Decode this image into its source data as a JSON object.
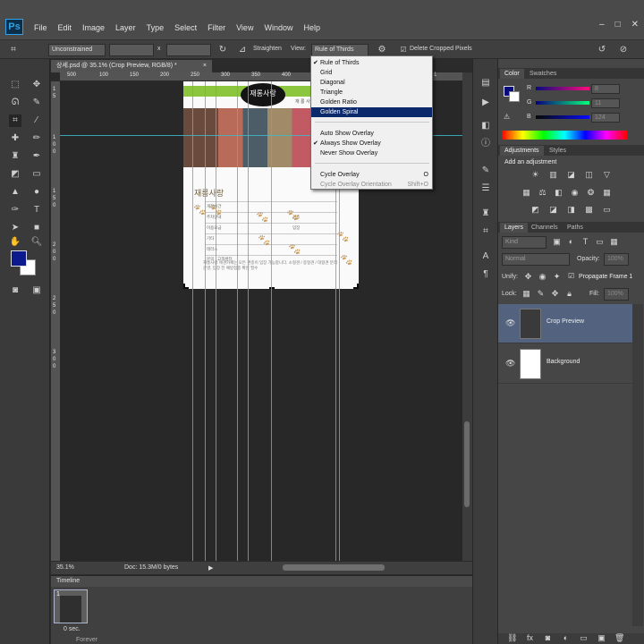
{
  "app": {
    "logo": "Ps",
    "menus": [
      "File",
      "Edit",
      "Image",
      "Layer",
      "Type",
      "Select",
      "Filter",
      "View",
      "Window",
      "Help"
    ],
    "window_controls": [
      "–",
      "□",
      "✕"
    ]
  },
  "options_bar": {
    "ratio_value": "Unconstrained",
    "width_value": "",
    "ratio_separator": "x",
    "height_value": "",
    "straighten_label": "Straighten",
    "view_label": "View:",
    "view_value": "Rule of Thirds",
    "delete_cropped_label": "Delete Cropped Pixels",
    "delete_cropped_checked": true
  },
  "document": {
    "tab_title": "상세.psd @ 35.1% (Crop Preview, RGB/8) *",
    "close": "×",
    "ruler_ticks_h": [
      "500",
      "100",
      "150",
      "200",
      "250",
      "300",
      "350",
      "400",
      "450",
      "500",
      "550",
      "600",
      "1"
    ],
    "ruler_ticks_v": [
      "1",
      "5",
      "1",
      "0",
      "0",
      "1",
      "5",
      "0",
      "2",
      "0",
      "0",
      "2",
      "5",
      "0",
      "3",
      "0",
      "0"
    ],
    "logo_text": "재롱사랑",
    "sub_text": "재 롱 사 랑 애 견 카 페",
    "section_title": "재롱사랑",
    "row_labels": [
      "개장시간",
      "주차안내",
      "이용요금",
      "기타",
      "테라스",
      "견종",
      "입장",
      "문의 : 고객센터"
    ],
    "footer_text": "재롱사랑 애견카페는 모든 견종이 입장 가능합니다. 소형견 / 중형견 / 대형견 분리 운영, 입장 전 예방접종 확인 필수"
  },
  "status": {
    "zoom": "35.1%",
    "doc_size": "Doc: 15.3M/0 bytes"
  },
  "timeline": {
    "title": "Timeline",
    "frame_number": "1",
    "frame_delay": "0 sec.",
    "loop": "Forever"
  },
  "color_panel": {
    "tabs": [
      "Color",
      "Swatches"
    ],
    "r_label": "R",
    "r_value": "8",
    "g_label": "G",
    "g_value": "11",
    "b_label": "B",
    "b_value": "124",
    "foreground": "#080b7c"
  },
  "adjustments_panel": {
    "tabs": [
      "Adjustments",
      "Styles"
    ],
    "heading": "Add an adjustment"
  },
  "layers_panel": {
    "tabs": [
      "Layers",
      "Channels",
      "Paths"
    ],
    "filter_value": "Kind",
    "blend_mode": "Normal",
    "opacity_label": "Opacity:",
    "opacity_value": "100%",
    "unify_label": "Unify:",
    "propagate_label": "Propagate Frame 1",
    "lock_label": "Lock:",
    "fill_label": "Fill:",
    "fill_value": "100%",
    "layers": [
      {
        "name": "Crop Preview",
        "selected": true
      },
      {
        "name": "Background",
        "selected": false
      }
    ]
  },
  "view_menu": {
    "items": [
      {
        "label": "Rule of Thirds",
        "checked": true
      },
      {
        "label": "Grid"
      },
      {
        "label": "Diagonal"
      },
      {
        "label": "Triangle"
      },
      {
        "label": "Golden Ratio"
      },
      {
        "label": "Golden Spiral",
        "highlighted": true
      }
    ],
    "options": [
      {
        "label": "Auto Show Overlay"
      },
      {
        "label": "Always Show Overlay",
        "checked": true
      },
      {
        "label": "Never Show Overlay"
      }
    ],
    "cycle": {
      "label": "Cycle Overlay",
      "shortcut": "O"
    },
    "cycle_orientation": {
      "label": "Cycle Overlay Orientation",
      "shortcut": "Shift+O"
    }
  }
}
